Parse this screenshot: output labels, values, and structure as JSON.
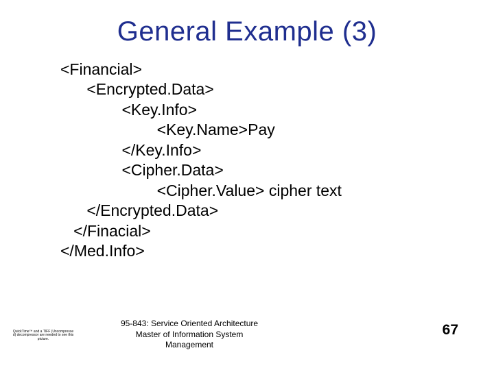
{
  "title": "General Example (3)",
  "code_lines": [
    "<Financial>",
    "      <Encrypted.Data>",
    "              <Key.Info>",
    "                      <Key.Name>Pay",
    "              </Key.Info>",
    "              <Cipher.Data>",
    "                      <Cipher.Value> cipher text",
    "      </Encrypted.Data>",
    "   </Finacial>",
    "</Med.Info>"
  ],
  "footer": {
    "course": "95-843: Service Oriented Architecture",
    "program_line1": "Master of Information System",
    "program_line2": "Management",
    "micro": "QuickTime™ and a TIFF (Uncompressed) decompressor are needed to see this picture."
  },
  "page_number": "67"
}
